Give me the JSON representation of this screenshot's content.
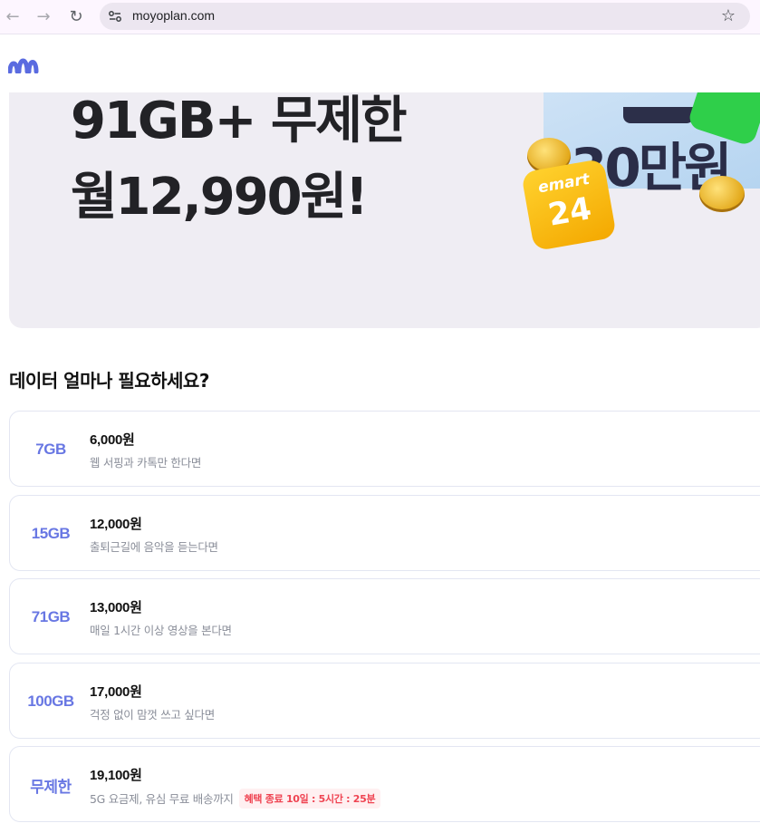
{
  "browser": {
    "url": "moyoplan.com"
  },
  "banner": {
    "line1": "91GB+ 무제한",
    "line2": "월12,990원!",
    "promo_amount": "30만원",
    "emart_brand": "emart",
    "emart_number": "24"
  },
  "section": {
    "title": "데이터 얼마나 필요하세요?"
  },
  "plans": [
    {
      "data": "7GB",
      "price": "6,000원",
      "desc": "웹 서핑과 카톡만 한다면"
    },
    {
      "data": "15GB",
      "price": "12,000원",
      "desc": "출퇴근길에 음악을 듣는다면"
    },
    {
      "data": "71GB",
      "price": "13,000원",
      "desc": "매일 1시간 이상 영상을 본다면"
    },
    {
      "data": "100GB",
      "price": "17,000원",
      "desc": "걱정 없이 맘껏 쓰고 싶다면"
    },
    {
      "data": "무제한",
      "price": "19,100원",
      "desc": "5G 요금제, 유심 무료 배송까지",
      "badge": "혜택 종료 10일 : 5시간 : 25분"
    }
  ],
  "colors": {
    "accent": "#6877e3",
    "badge_text": "#ef4452",
    "badge_bg": "#fff0f1"
  }
}
